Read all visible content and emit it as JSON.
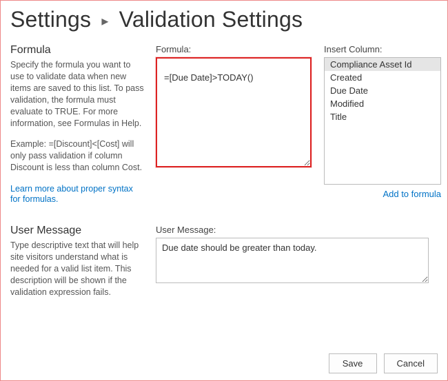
{
  "breadcrumb": {
    "root": "Settings",
    "current": "Validation Settings"
  },
  "formula_section": {
    "heading": "Formula",
    "help1": "Specify the formula you want to use to validate data when new items are saved to this list. To pass validation, the formula must evaluate to TRUE. For more information, see Formulas in Help.",
    "help2": "Example: =[Discount]<[Cost] will only pass validation if column Discount is less than column Cost.",
    "learn_link": "Learn more about proper syntax for formulas.",
    "field_label": "Formula:",
    "field_value": "=[Due Date]>TODAY()",
    "insert_label": "Insert Column:",
    "columns": [
      {
        "label": "Compliance Asset Id",
        "selected": true
      },
      {
        "label": "Created",
        "selected": false
      },
      {
        "label": "Due Date",
        "selected": false
      },
      {
        "label": "Modified",
        "selected": false
      },
      {
        "label": "Title",
        "selected": false
      }
    ],
    "add_link": "Add to formula"
  },
  "message_section": {
    "heading": "User Message",
    "help": "Type descriptive text that will help site visitors understand what is needed for a valid list item. This description will be shown if the validation expression fails.",
    "field_label": "User Message:",
    "field_value": "Due date should be greater than today."
  },
  "buttons": {
    "save": "Save",
    "cancel": "Cancel"
  }
}
